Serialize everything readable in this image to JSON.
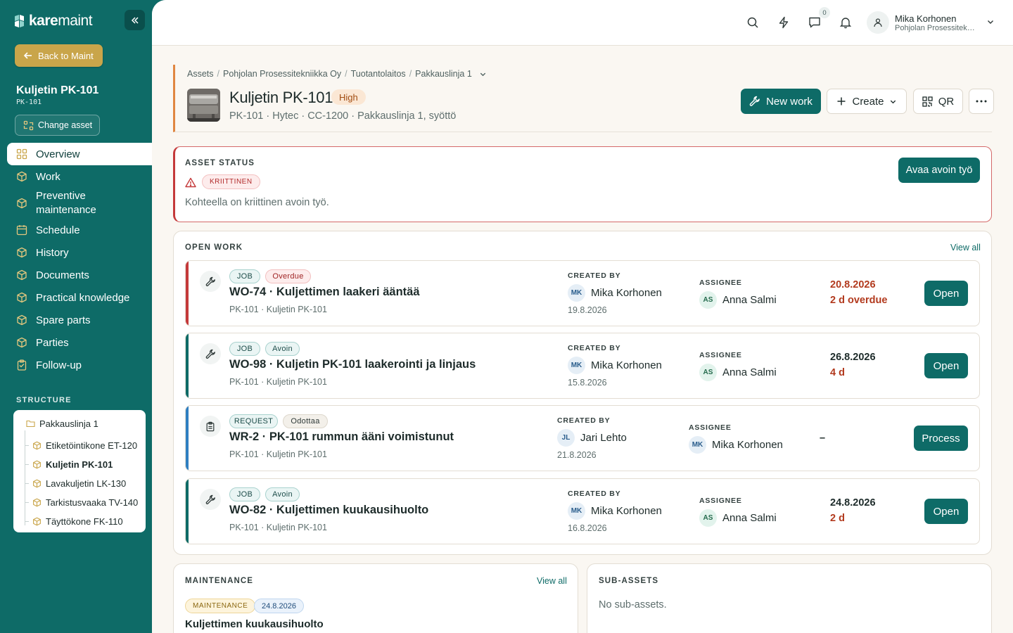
{
  "app": {
    "logo_bold": "kare",
    "logo_light": "maint"
  },
  "sidebar": {
    "back_label": "Back to Maint",
    "asset_name": "Kuljetin PK-101",
    "asset_code": "PK-101",
    "change_label": "Change asset",
    "nav": [
      {
        "label": "Overview",
        "icon": "grid-icon",
        "active": true
      },
      {
        "label": "Work",
        "icon": "cube-icon"
      },
      {
        "label": "Preventive maintenance",
        "icon": "cube-icon"
      },
      {
        "label": "Schedule",
        "icon": "calendar-icon"
      },
      {
        "label": "History",
        "icon": "cube-icon"
      },
      {
        "label": "Documents",
        "icon": "cube-icon"
      },
      {
        "label": "Practical knowledge",
        "icon": "cube-icon"
      },
      {
        "label": "Spare parts",
        "icon": "cube-icon"
      },
      {
        "label": "Parties",
        "icon": "cube-icon"
      },
      {
        "label": "Follow-up",
        "icon": "clipboard-icon"
      }
    ],
    "structure_title": "STRUCTURE",
    "tree_root": "Pakkauslinja 1",
    "tree_children": [
      "Etiketöintikone ET-120",
      "Kuljetin PK-101",
      "Lavakuljetin LK-130",
      "Tarkistusvaaka TV-140",
      "Täyttökone FK-110"
    ]
  },
  "topbar": {
    "chat_count": "0",
    "user_name": "Mika Korhonen",
    "user_org": "Pohjolan Prosessitekniikka Oy"
  },
  "header": {
    "breadcrumbs": [
      "Assets",
      "Pohjolan Prosessitekniikka Oy",
      "Tuotantolaitos",
      "Pakkauslinja 1"
    ],
    "title": "Kuljetin PK-101",
    "priority": "High",
    "subtitle": "PK-101 · Hytec · CC-1200 · Pakkauslinja 1, syöttö",
    "new_work": "New work",
    "create": "Create",
    "qr": "QR"
  },
  "status": {
    "title": "ASSET STATUS",
    "badge": "KRIITTINEN",
    "description": "Kohteella on kriittinen avoin työ.",
    "action": "Avaa avoin työ"
  },
  "open_work": {
    "title": "OPEN WORK",
    "view_all": "View all",
    "created_by_label": "CREATED BY",
    "assignee_label": "ASSIGNEE",
    "items": [
      {
        "type": "JOB",
        "state": "Overdue",
        "title": "WO-74 · Kuljettimen laakeri ääntää",
        "location": "PK-101 · Kuljetin PK-101",
        "creator_initials": "MK",
        "creator": "Mika Korhonen",
        "created": "19.8.2026",
        "assignee_initials": "AS",
        "assignee": "Anna Salmi",
        "due": "20.8.2026",
        "due_rel": "2 d overdue",
        "action": "Open",
        "stripe": "#c4393a"
      },
      {
        "type": "JOB",
        "state": "Avoin",
        "title": "WO-98 · Kuljetin PK-101 laakerointi ja linjaus",
        "location": "PK-101 · Kuljetin PK-101",
        "creator_initials": "MK",
        "creator": "Mika Korhonen",
        "created": "15.8.2026",
        "assignee_initials": "AS",
        "assignee": "Anna Salmi",
        "due": "26.8.2026",
        "due_rel": "4 d",
        "action": "Open",
        "stripe": "#0e6b67"
      },
      {
        "type": "REQUEST",
        "state": "Odottaa",
        "title": "WR-2 · PK-101 rummun ääni voimistunut",
        "location": "PK-101 · Kuljetin PK-101",
        "creator_initials": "JL",
        "creator": "Jari Lehto",
        "created": "21.8.2026",
        "assignee_initials": "MK",
        "assignee": "Mika Korhonen",
        "due": "–",
        "due_rel": "",
        "action": "Process",
        "stripe": "#2f7fc1"
      },
      {
        "type": "JOB",
        "state": "Avoin",
        "title": "WO-82 · Kuljettimen kuukausihuolto",
        "location": "PK-101 · Kuljetin PK-101",
        "creator_initials": "MK",
        "creator": "Mika Korhonen",
        "created": "16.8.2026",
        "assignee_initials": "AS",
        "assignee": "Anna Salmi",
        "due": "24.8.2026",
        "due_rel": "2 d",
        "action": "Open",
        "stripe": "#0e6b67"
      }
    ]
  },
  "maintenance": {
    "title": "MAINTENANCE",
    "view_all": "View all",
    "badge": "MAINTENANCE",
    "date": "24.8.2026",
    "name": "Kuljettimen kuukausihuolto"
  },
  "sub_assets": {
    "title": "SUB-ASSETS",
    "empty": "No sub-assets."
  },
  "colors": {
    "brand": "#0e6b67",
    "accent_gold": "#c9a54a",
    "danger": "#c4393a",
    "warning": "#e08642",
    "info": "#2f7fc1"
  }
}
